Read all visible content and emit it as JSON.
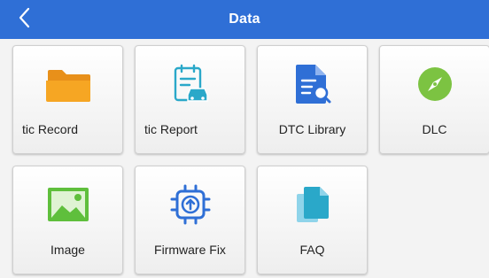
{
  "header": {
    "title": "Data",
    "back_icon": "chevron-left-icon",
    "background": "#2f6fd6"
  },
  "tiles": [
    {
      "label": "tic Record",
      "icon": "folder-icon"
    },
    {
      "label": "tic Report",
      "icon": "clipboard-car-icon"
    },
    {
      "label": "DTC Library",
      "icon": "document-search-icon"
    },
    {
      "label": "DLC",
      "icon": "compass-icon"
    },
    {
      "label": "Image",
      "icon": "image-icon"
    },
    {
      "label": "Firmware Fix",
      "icon": "chip-upload-icon"
    },
    {
      "label": "FAQ",
      "icon": "copy-pages-icon"
    }
  ],
  "colors": {
    "accent_blue": "#2f6fd6",
    "folder_orange": "#f6a623",
    "icon_teal": "#2aa8c9",
    "compass_green": "#7cc342",
    "image_green": "#5fbf3c"
  }
}
